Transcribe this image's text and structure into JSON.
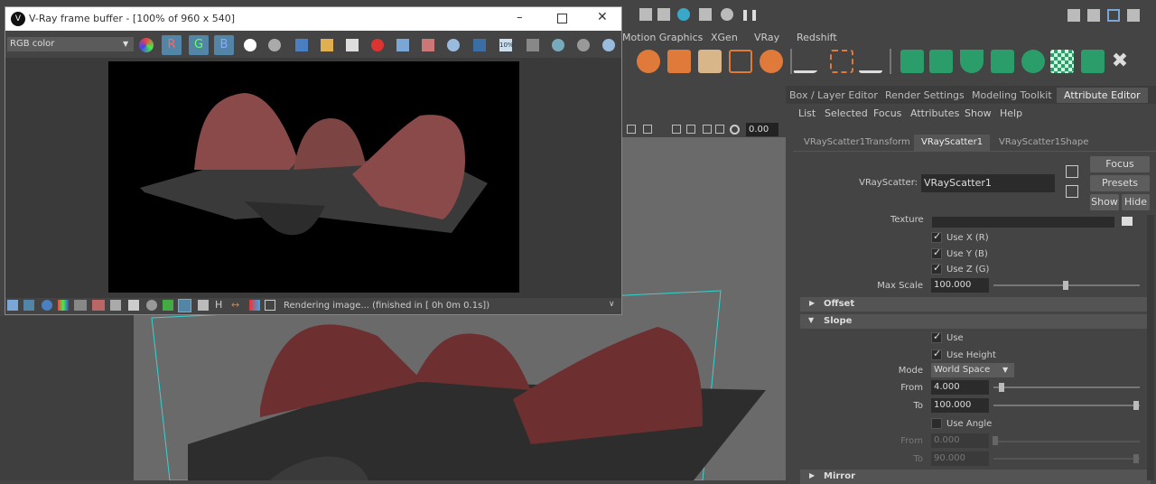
{
  "maya": {
    "shelf_tabs": [
      "Motion Graphics",
      "XGen",
      "VRay",
      "Redshift"
    ],
    "panel_tabs": [
      "Box / Layer Editor",
      "Render Settings",
      "Modeling Toolkit",
      "Attribute Editor"
    ],
    "ae_menu": [
      "List",
      "Selected",
      "Focus",
      "Attributes",
      "Show",
      "Help"
    ],
    "node_tabs": [
      "VRayScatter1Transform",
      "VRayScatter1",
      "VRayScatter1Shape"
    ],
    "viewport_value": "0.00"
  },
  "ae": {
    "node_label": "VRayScatter:",
    "node_name": "VRayScatter1",
    "focus_label": "Focus",
    "presets_label": "Presets",
    "show_label": "Show",
    "hide_label": "Hide",
    "texture_label": "Texture",
    "use_x": "Use X (R)",
    "use_y": "Use Y (B)",
    "use_z": "Use Z (G)",
    "max_scale_label": "Max Scale",
    "max_scale": "100.000",
    "offset_section": "Offset",
    "slope_section": "Slope",
    "use_label": "Use",
    "use_height": "Use Height",
    "mode_label": "Mode",
    "mode_value": "World Space",
    "from_label": "From",
    "from_value": "4.000",
    "to_label": "To",
    "to_value": "100.000",
    "use_angle": "Use Angle",
    "from2_label": "From",
    "from2_value": "0.000",
    "to2_label": "To",
    "to2_value": "90.000",
    "mirror_section": "Mirror"
  },
  "vfb": {
    "title": "V-Ray frame buffer - [100% of 960 x 540]",
    "channel": "RGB color",
    "r": "R",
    "g": "G",
    "b": "B",
    "status": "Rendering image... (finished in [ 0h  0m  0.1s])"
  },
  "colors": {
    "accent": "#5285a6",
    "scatter": "#8a4a4a",
    "green_icon": "#2a9d6a"
  }
}
